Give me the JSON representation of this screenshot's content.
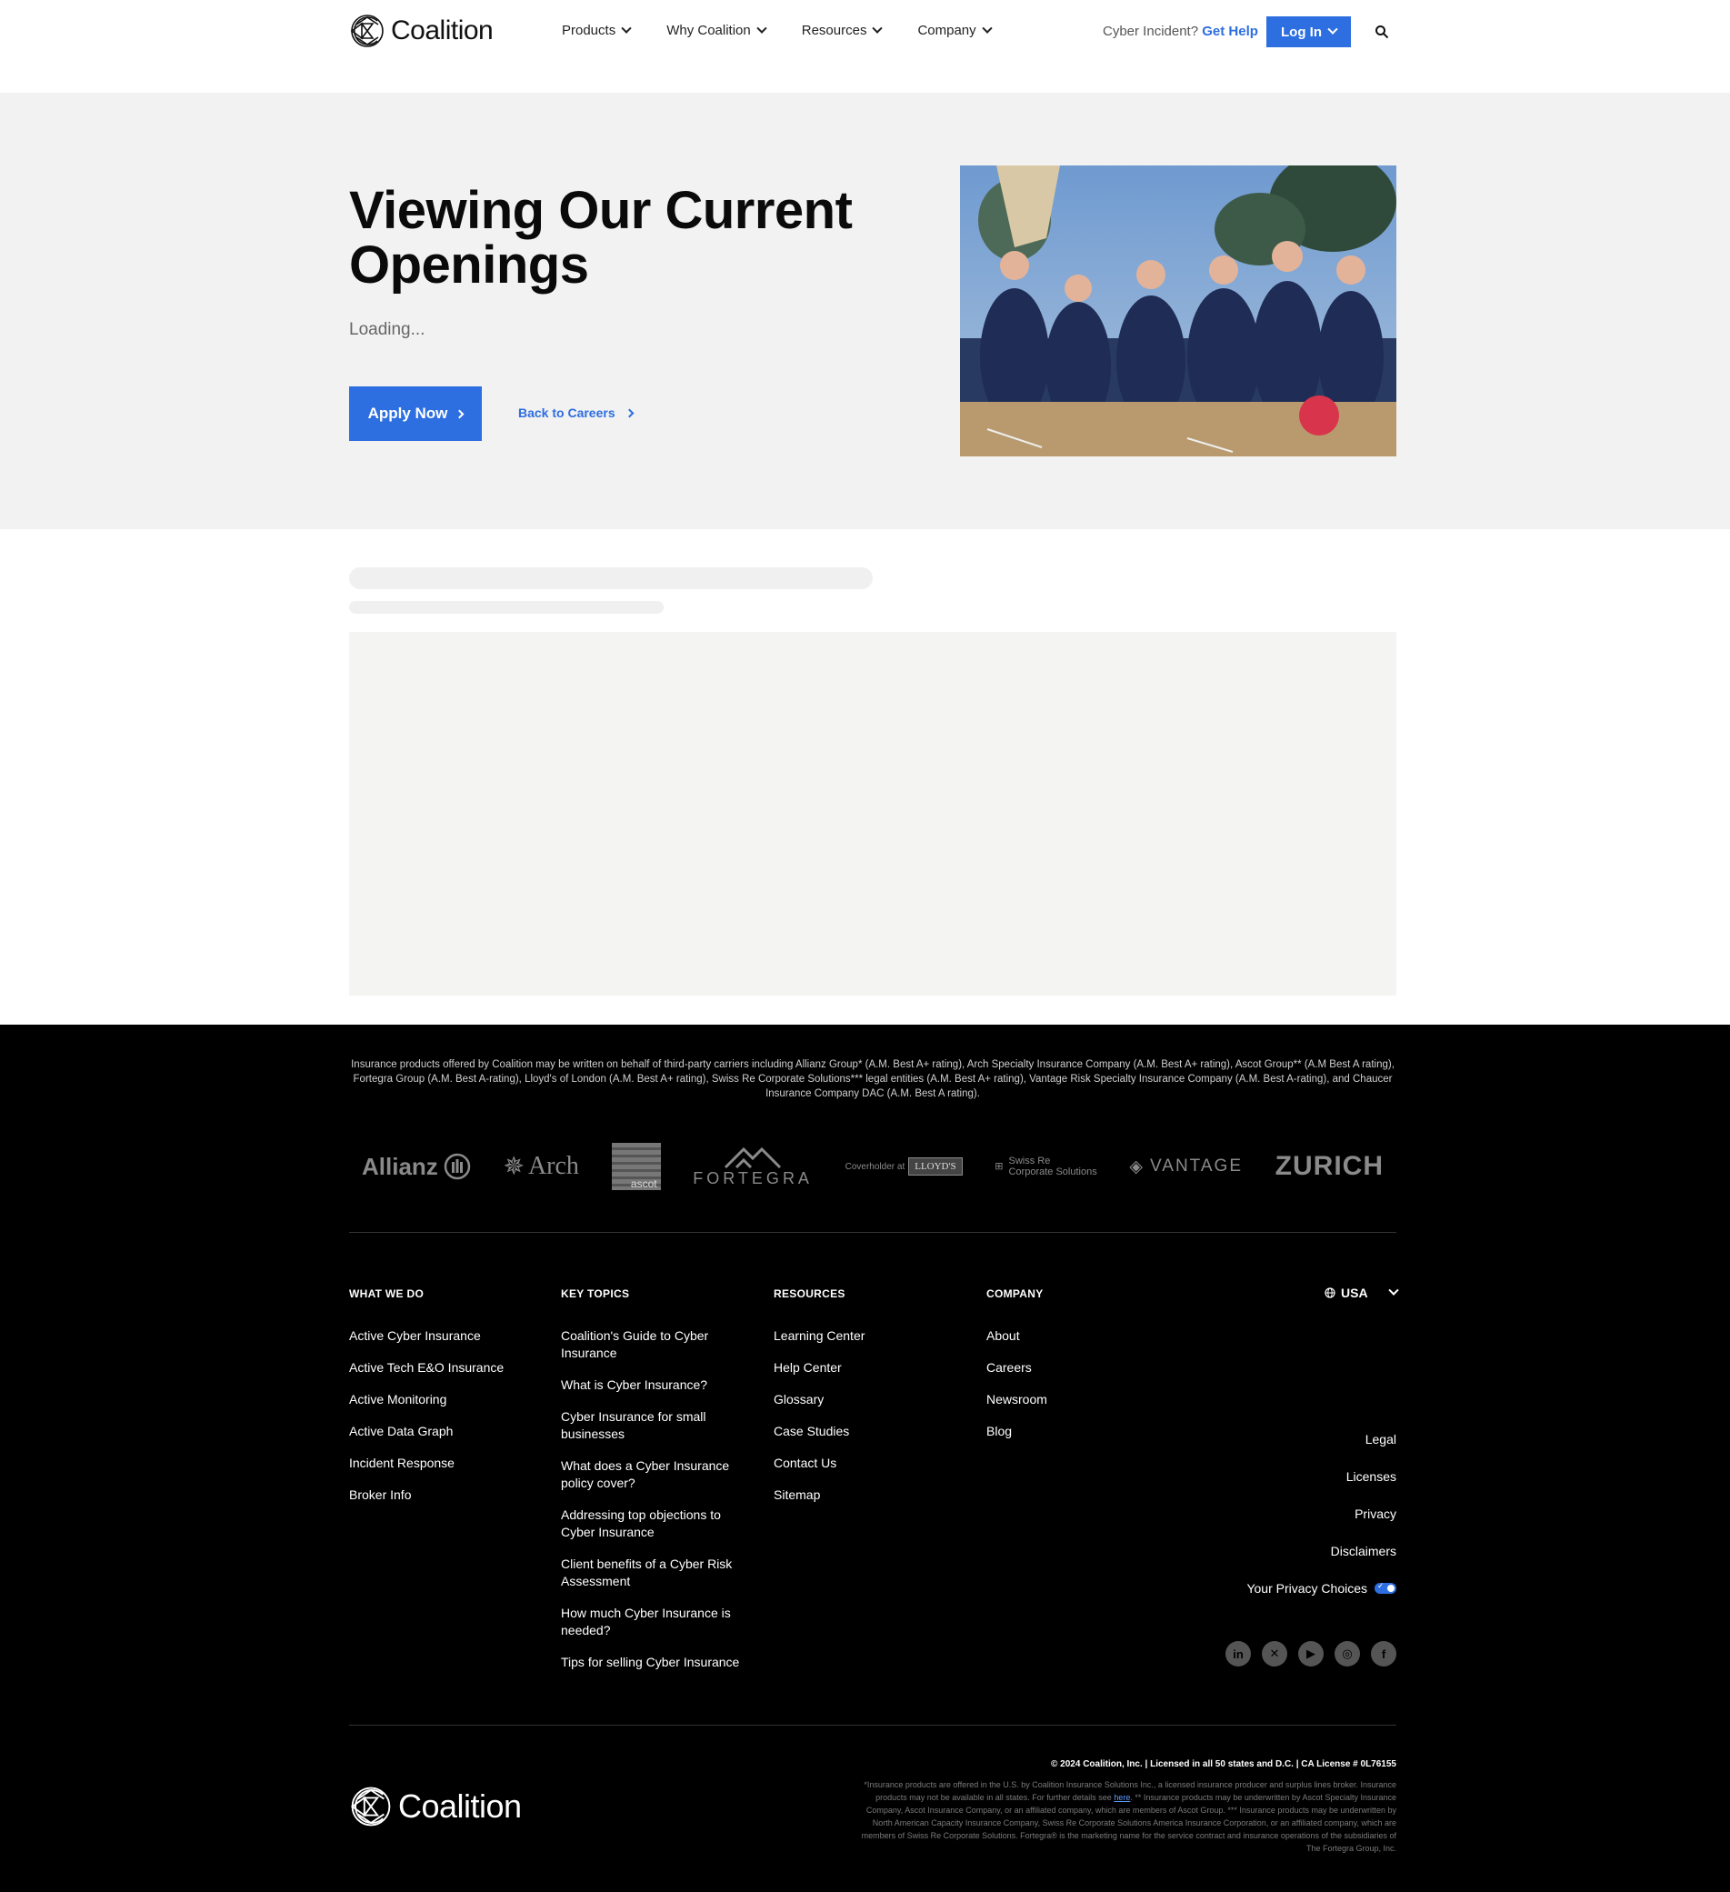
{
  "header": {
    "brand": "Coalition",
    "nav": [
      "Products",
      "Why Coalition",
      "Resources",
      "Company"
    ],
    "incident_prefix": "Cyber Incident?",
    "incident_link": "Get Help",
    "login_label": "Log In",
    "search_icon": "search-icon"
  },
  "hero": {
    "title": "Viewing Our Current Openings",
    "status": "Loading...",
    "apply_label": "Apply Now",
    "back_label": "Back to Careers"
  },
  "footer": {
    "disclosure": "Insurance products offered by Coalition may be written on behalf of third-party carriers including Allianz Group* (A.M. Best A+ rating), Arch Specialty Insurance Company (A.M. Best A+ rating), Ascot Group** (A.M Best A rating), Fortegra Group (A.M. Best A-rating), Lloyd's of London (A.M. Best A+ rating), Swiss Re Corporate Solutions*** legal entities (A.M. Best A+ rating), Vantage Risk Specialty Insurance Company (A.M. Best A-rating), and Chaucer Insurance Company DAC (A.M. Best A rating).",
    "carriers": {
      "allianz": "Allianz",
      "arch": "Arch",
      "ascot": "ascot",
      "fortegra": "FORTEGRA",
      "lloyds_prefix": "Coverholder at",
      "lloyds": "LLOYD'S",
      "swissre_line1": "Swiss Re",
      "swissre_line2": "Corporate Solutions",
      "vantage": "VANTAGE",
      "zurich": "ZURICH"
    },
    "columns": [
      {
        "heading": "WHAT WE DO",
        "links": [
          "Active Cyber Insurance",
          "Active Tech E&O Insurance",
          "Active Monitoring",
          "Active Data Graph",
          "Incident Response",
          "Broker Info"
        ]
      },
      {
        "heading": "KEY TOPICS",
        "links": [
          "Coalition's Guide to Cyber Insurance",
          "What is Cyber Insurance?",
          "Cyber Insurance for small businesses",
          "What does a Cyber Insurance policy cover?",
          "Addressing top objections to Cyber Insurance",
          "Client benefits of a Cyber Risk Assessment",
          "How much Cyber Insurance is needed?",
          "Tips for selling Cyber Insurance"
        ]
      },
      {
        "heading": "RESOURCES",
        "links": [
          "Learning Center",
          "Help Center",
          "Glossary",
          "Case Studies",
          "Contact Us",
          "Sitemap"
        ]
      },
      {
        "heading": "COMPANY",
        "links": [
          "About",
          "Careers",
          "Newsroom",
          "Blog"
        ]
      }
    ],
    "region": "USA",
    "legal_links": [
      "Legal",
      "Licenses",
      "Privacy",
      "Disclaimers"
    ],
    "privacy_choices": "Your Privacy Choices",
    "socials": [
      "linkedin-icon",
      "x-icon",
      "youtube-icon",
      "instagram-icon",
      "facebook-icon"
    ],
    "copyright": "© 2024 Coalition, Inc. | Licensed in all 50 states and D.C. | CA License # 0L76155",
    "fine_print_1": "*Insurance products are offered in the U.S. by Coalition Insurance Solutions Inc., a licensed insurance producer and surplus lines broker. Insurance products may not be available in all states. For further details see",
    "fine_print_link": "here",
    "fine_print_2": ". ** Insurance products may be underwritten by Ascot Specialty Insurance Company, Ascot Insurance Company, or an affiliated company, which are members of Ascot Group. *** Insurance products may be underwritten by North American Capacity Insurance Company, Swiss Re Corporate Solutions America Insurance Corporation, or an affiliated company, which are members of Swiss Re Corporate Solutions. Fortegra® is the marketing name for the service contract and insurance operations of the subsidiaries of The Fortegra Group, Inc."
  },
  "colors": {
    "accent": "#2d6ee0",
    "hero_bg": "#f2f2f2",
    "footer_bg": "#000000"
  }
}
